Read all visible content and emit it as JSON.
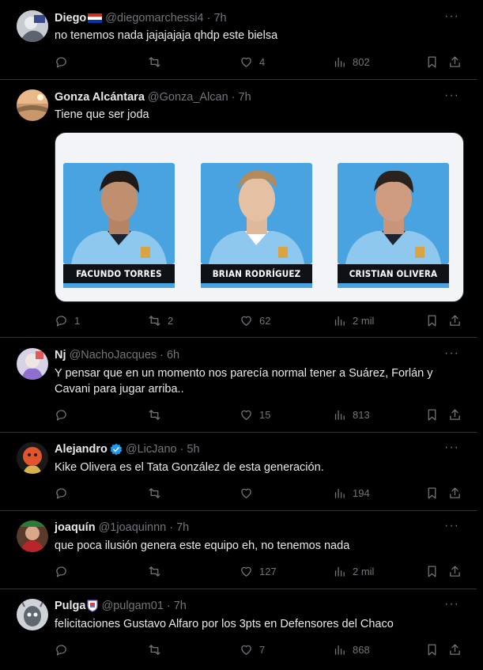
{
  "tweets": [
    {
      "name": "Diego",
      "flag": "paraguay-flag",
      "handle": "@diegomarchessi4",
      "time": "7h",
      "text": "no tenemos nada jajajajaja qhdp este bielsa",
      "stats": {
        "replies": "",
        "retweets": "",
        "likes": "4",
        "views": "802"
      }
    },
    {
      "name": "Gonza Alcántara",
      "handle": "@Gonza_Alcan",
      "time": "7h",
      "text": "Tiene que ser joda",
      "media": {
        "players": [
          "FACUNDO TORRES",
          "BRIAN RODRÍGUEZ",
          "CRISTIAN OLIVERA"
        ],
        "colors": {
          "background": "#49a3e0",
          "label": "#0e1116",
          "card": "#f2f4f7"
        }
      },
      "stats": {
        "replies": "1",
        "retweets": "2",
        "likes": "62",
        "views": "2 mil"
      }
    },
    {
      "name": "Nj",
      "handle": "@NachoJacques",
      "time": "6h",
      "text": "Y pensar que en un momento nos parecía normal tener a Suárez, Forlán y Cavani para jugar arriba..",
      "stats": {
        "replies": "",
        "retweets": "",
        "likes": "15",
        "views": "813"
      }
    },
    {
      "name": "Alejandro",
      "verified": true,
      "handle": "@LicJano",
      "time": "5h",
      "text": "Kike Olivera es el Tata González de esta generación.",
      "stats": {
        "replies": "",
        "retweets": "",
        "likes": "",
        "views": "194"
      }
    },
    {
      "name": "joaquín",
      "handle": "@1joaquinnn",
      "time": "7h",
      "text": "que poca ilusión genera este equipo eh, no tenemos nada",
      "stats": {
        "replies": "",
        "retweets": "",
        "likes": "127",
        "views": "2 mil"
      }
    },
    {
      "name": "Pulga",
      "badge": "team-crest-emoji",
      "handle": "@pulgam01",
      "time": "7h",
      "text": "felicitaciones Gustavo Alfaro por los 3pts en Defensores del Chaco",
      "stats": {
        "replies": "",
        "retweets": "",
        "likes": "7",
        "views": "868"
      }
    }
  ],
  "ui": {
    "separator": "·",
    "more": "···"
  },
  "colors": {
    "background": "#000000",
    "text": "#e7e9ea",
    "muted": "#71767b",
    "border": "#2f3336",
    "verified": "#1d9bf0"
  }
}
